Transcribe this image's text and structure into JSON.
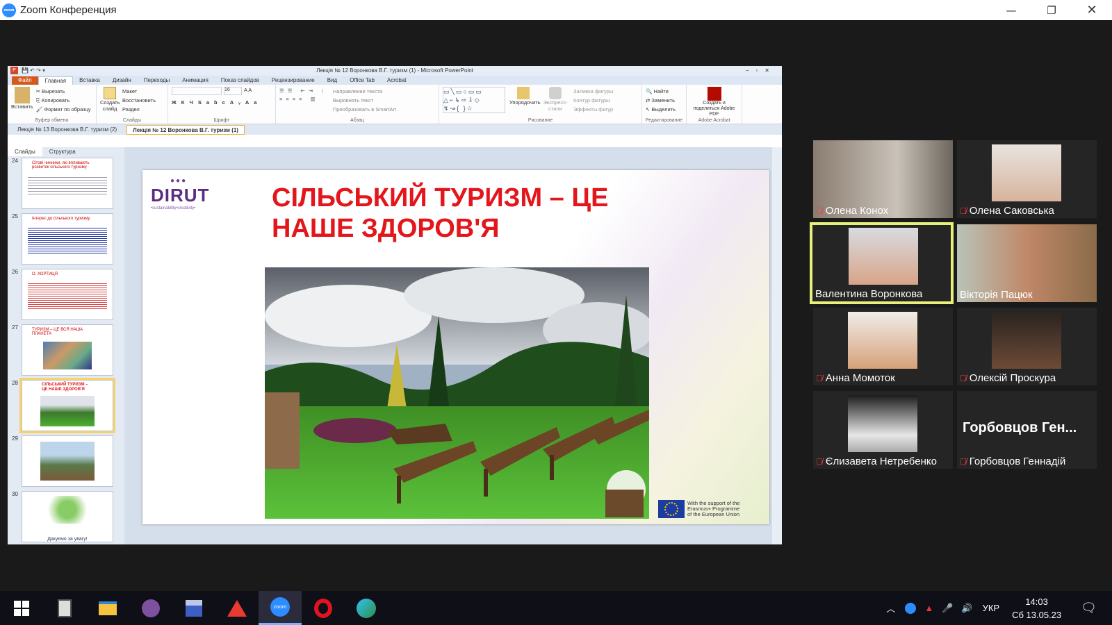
{
  "window": {
    "title": "Zoom Конференция"
  },
  "powerpoint": {
    "title": "Лекція № 12 Воронкова В.Г. туризм  (1)  -  Microsoft PowerPoint",
    "tabs": [
      "Файл",
      "Главная",
      "Вставка",
      "Дизайн",
      "Переходы",
      "Анимация",
      "Показ слайдов",
      "Рецензирование",
      "Вид",
      "Office Tab",
      "Acrobat"
    ],
    "ribbon": {
      "paste": "Вставить",
      "cut": "Вырезать",
      "copy": "Копировать",
      "format": "Формат по образцу",
      "clipboard": "Буфер обмена",
      "new_slide": "Создать слайд",
      "layout": "Макет",
      "reset": "Восстановить",
      "section": "Раздел",
      "slides": "Слайды",
      "font_size": "16",
      "font": "Шрифт",
      "text_dir": "Направление текста",
      "align_text": "Выровнять текст",
      "smartart": "Преобразовать в SmartArt",
      "paragraph": "Абзац",
      "arrange": "Упорядочить",
      "quick_styles": "Экспресс-стили",
      "fill": "Заливка фигуры",
      "outline": "Контур фигуры",
      "effects": "Эффекты фигур",
      "drawing": "Рисование",
      "find": "Найти",
      "replace": "Заменить",
      "select": "Выделить",
      "editing": "Редактирование",
      "create_pdf": "Создать и поделиться Adobe PDF",
      "adobe": "Adobe Acrobat"
    },
    "doc_tabs": [
      "Лекція № 13 Воронкова В.Г. туризм  (2)",
      "Лекція № 12 Воронкова В.Г. туризм  (1)"
    ],
    "pane_tabs": [
      "Слайды",
      "Структура"
    ],
    "thumbs": [
      {
        "num": "24",
        "title": "Сітові чинники, які впливають розвиток сільського туризму"
      },
      {
        "num": "25",
        "title": "Інтерес до сільського туризму"
      },
      {
        "num": "26",
        "title": "О. ХОРТИЦЯ"
      },
      {
        "num": "27",
        "title": "ТУРИЗМ – ЦЕ ВСЯ НАША ПЛАНЕТА"
      },
      {
        "num": "28",
        "title": "СІЛЬСЬКИЙ ТУРИЗМ – ЦЕ НАШЕ ЗДОРОВ'Я"
      },
      {
        "num": "29",
        "title": ""
      },
      {
        "num": "30",
        "title": "Дякуємо за увагу!"
      }
    ],
    "slide": {
      "logo": "DIRUT",
      "logo_sub": "•sustainability•creativity•",
      "title_line1": "СІЛЬСЬКИЙ ТУРИЗМ – ЦЕ",
      "title_line2": "НАШЕ ЗДОРОВ'Я",
      "eu_line1": "With the support of the",
      "eu_line2": "Erasmus+ Programme",
      "eu_line3": "of the European Union"
    }
  },
  "participants": [
    {
      "name": "Олена Конох",
      "muted": true
    },
    {
      "name": "Олена Саковська",
      "muted": true
    },
    {
      "name": "Валентина Воронкова",
      "muted": false,
      "active": true
    },
    {
      "name": "Вікторія Пацюк",
      "muted": false
    },
    {
      "name": "Анна Момоток",
      "muted": true
    },
    {
      "name": "Олексій Проскура",
      "muted": true
    },
    {
      "name": "Єлизавета Нетребенко",
      "muted": true
    },
    {
      "name": "Горбовцов Геннадій",
      "muted": true,
      "tile_text": "Горбовцов   Ген..."
    }
  ],
  "taskbar": {
    "lang": "УКР",
    "time": "14:03",
    "date": "Сб 13.05.23",
    "zoom": "zoom"
  }
}
